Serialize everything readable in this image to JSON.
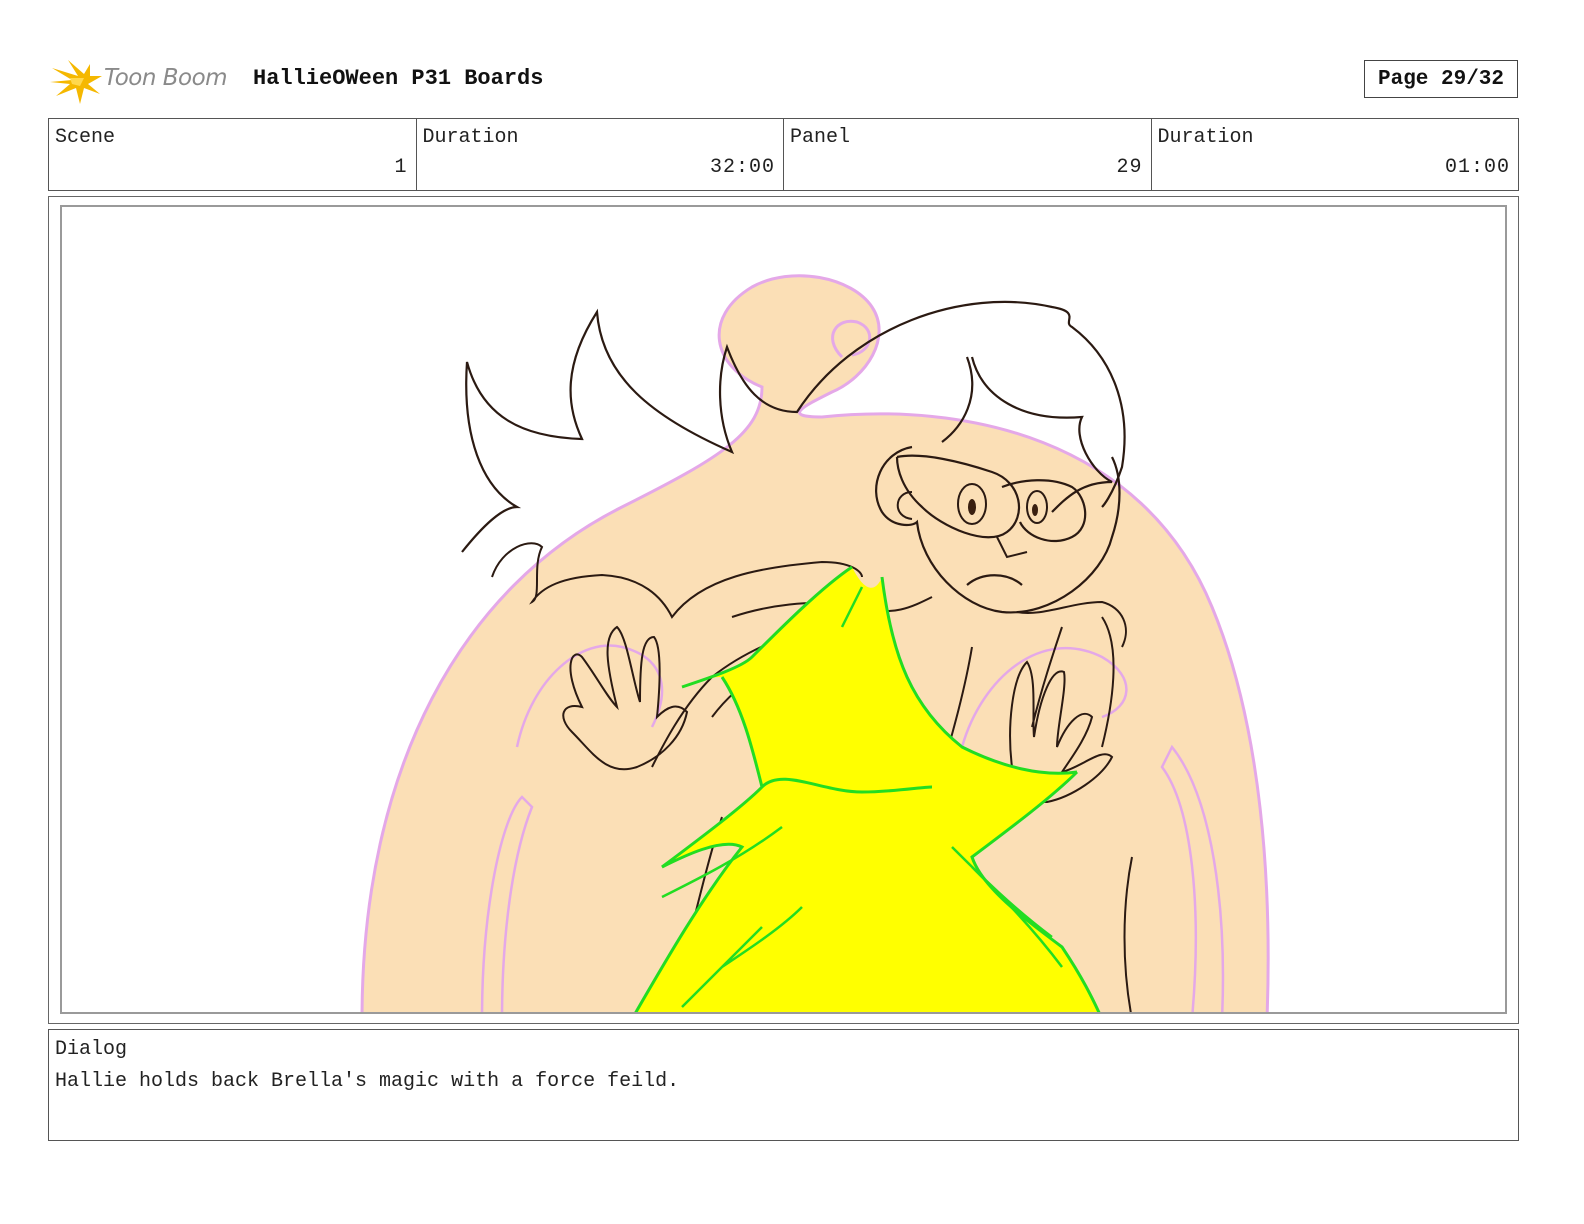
{
  "header": {
    "logo_text": "Toon Boom",
    "project_title": "HallieOWeen P31 Boards",
    "page": "Page 29/32"
  },
  "info": {
    "scene_label": "Scene",
    "scene_value": "1",
    "scene_duration_label": "Duration",
    "scene_duration_value": "32:00",
    "panel_label": "Panel",
    "panel_value": "29",
    "panel_duration_label": "Duration",
    "panel_duration_value": "01:00"
  },
  "dialog": {
    "label": "Dialog",
    "text": "Hallie holds back Brella's magic with a force feild."
  },
  "colors": {
    "force_field": "#fbdfb6",
    "field_outline": "#e4a8e8",
    "magic_fill": "#ffff00",
    "magic_outline": "#22dd22",
    "line_art": "#2b1a12",
    "logo_flame": "#f5b800"
  }
}
